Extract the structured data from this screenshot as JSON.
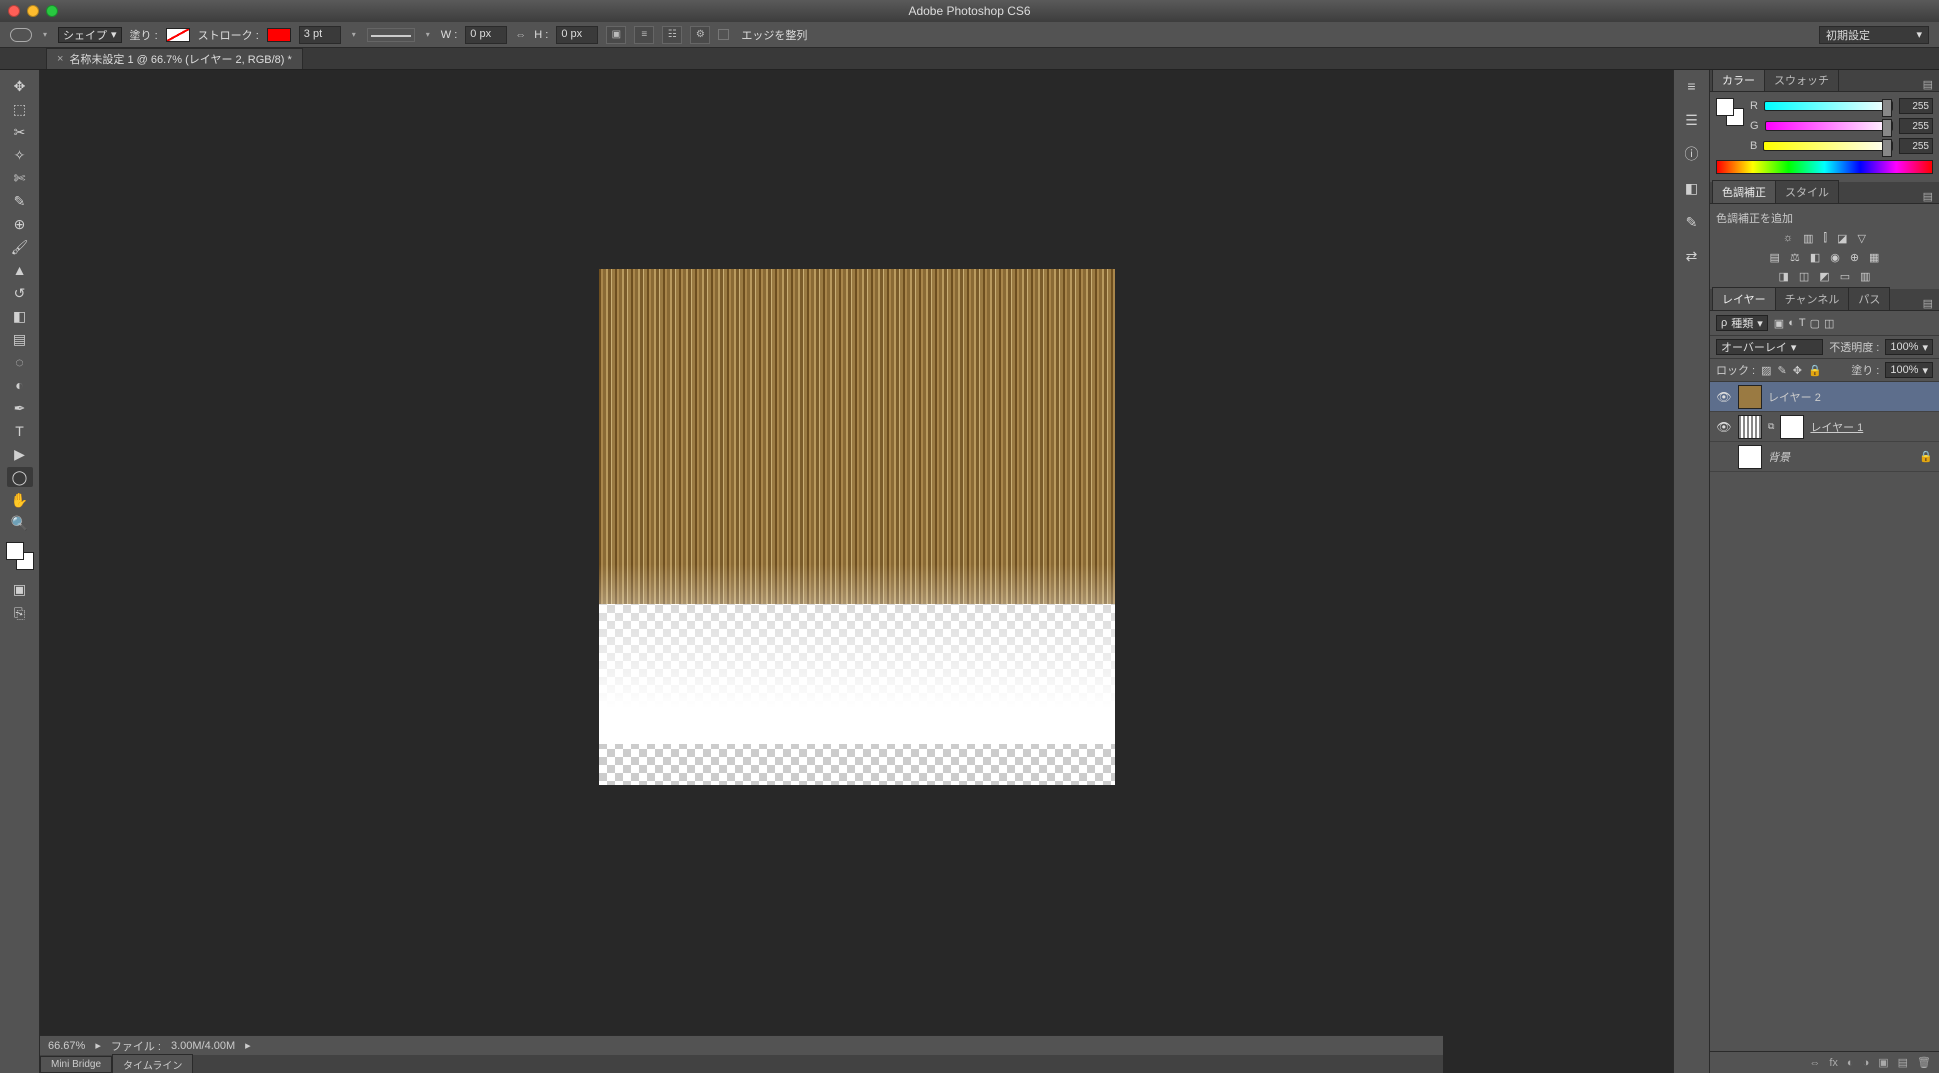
{
  "app": {
    "title": "Adobe Photoshop CS6"
  },
  "options": {
    "shape_label": "シェイプ",
    "fill_label": "塗り :",
    "stroke_label": "ストローク :",
    "stroke_color": "#ff0000",
    "stroke_width": "3 pt",
    "w_label": "W :",
    "w_val": "0 px",
    "h_label": "H :",
    "h_val": "0 px",
    "align_label": "エッジを整列",
    "workspace": "初期設定"
  },
  "doc": {
    "tab": "名称未設定 1 @ 66.7% (レイヤー 2, RGB/8) *"
  },
  "color": {
    "tab_color": "カラー",
    "tab_swatch": "スウォッチ",
    "r_lbl": "R",
    "g_lbl": "G",
    "b_lbl": "B",
    "r": "255",
    "g": "255",
    "b": "255"
  },
  "adjust": {
    "tab_adjust": "色調補正",
    "tab_style": "スタイル",
    "add_label": "色調補正を追加"
  },
  "layers": {
    "tab_layers": "レイヤー",
    "tab_channels": "チャンネル",
    "tab_paths": "パス",
    "kind_label": "種類",
    "blend_mode": "オーバーレイ",
    "opacity_label": "不透明度 :",
    "opacity": "100%",
    "lock_label": "ロック :",
    "fill_label": "塗り :",
    "fill": "100%",
    "items": [
      {
        "name": "レイヤー 2"
      },
      {
        "name": "レイヤー 1"
      },
      {
        "name": "背景"
      }
    ]
  },
  "status": {
    "zoom": "66.67%",
    "file_label": "ファイル :",
    "file_info": "3.00M/4.00M"
  },
  "bottom": {
    "mini_bridge": "Mini Bridge",
    "timeline": "タイムライン"
  }
}
